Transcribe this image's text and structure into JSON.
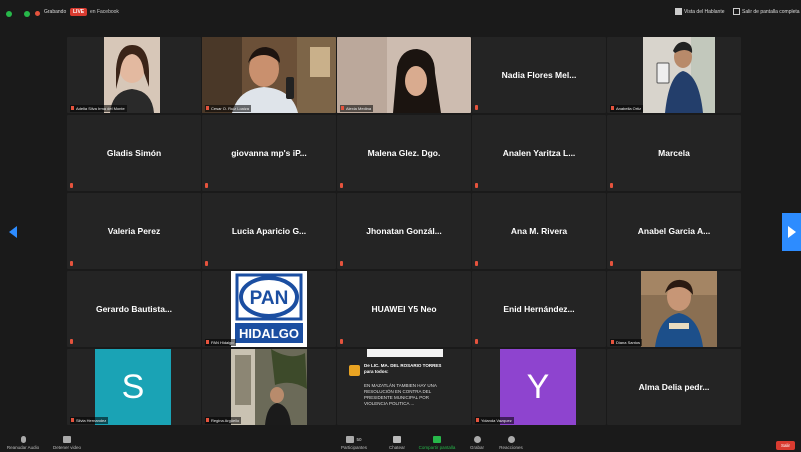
{
  "topbar": {
    "meeting_label": "Grabando",
    "live_badge": "LIVE",
    "live_text": "en Facebook",
    "view_label": "Vista del Hablante",
    "fullscreen_label": "Salir de pantalla completa"
  },
  "tiles": [
    {
      "id": "r0c0",
      "name": "Adelia Silva Irma del Monte",
      "kind": "photo"
    },
    {
      "id": "r0c1",
      "name": "Cesar O. Ruiz Loaiza",
      "kind": "photo"
    },
    {
      "id": "r0c2",
      "name": "Alexia Medina",
      "kind": "photo"
    },
    {
      "id": "r0c3",
      "name": "Nadia Flores Mel...",
      "kind": "text"
    },
    {
      "id": "r0c4",
      "name": "Anabella Ortiz",
      "kind": "photo"
    },
    {
      "id": "r1c0",
      "name": "Gladis Simón",
      "kind": "text"
    },
    {
      "id": "r1c1",
      "name": "giovanna mp's iP...",
      "kind": "text"
    },
    {
      "id": "r1c2",
      "name": "Malena Glez. Dgo.",
      "kind": "text"
    },
    {
      "id": "r1c3",
      "name": "Analen Yaritza L...",
      "kind": "text"
    },
    {
      "id": "r1c4",
      "name": "Marcela",
      "kind": "text"
    },
    {
      "id": "r2c0",
      "name": "Valeria Perez",
      "kind": "text"
    },
    {
      "id": "r2c1",
      "name": "Lucia Aparicio G...",
      "kind": "text"
    },
    {
      "id": "r2c2",
      "name": "Jhonatan Gonzál...",
      "kind": "text"
    },
    {
      "id": "r2c3",
      "name": "Ana M. Rivera",
      "kind": "text"
    },
    {
      "id": "r2c4",
      "name": "Anabel Garcia A...",
      "kind": "text"
    },
    {
      "id": "r3c0",
      "name": "Gerardo Bautista...",
      "kind": "text"
    },
    {
      "id": "r3c1",
      "name": "PAN Hidalgo",
      "kind": "logo"
    },
    {
      "id": "r3c2",
      "name": "HUAWEI Y5 Neo",
      "kind": "text"
    },
    {
      "id": "r3c3",
      "name": "Enid Hernández...",
      "kind": "text"
    },
    {
      "id": "r3c4",
      "name": "Diana Santos",
      "kind": "photo"
    },
    {
      "id": "r4c0",
      "name": "Silvia Hernandez",
      "kind": "avatar",
      "letter": "S"
    },
    {
      "id": "r4c1",
      "name": "Regina Argüello",
      "kind": "photo"
    },
    {
      "id": "r4c2",
      "name": "",
      "kind": "post"
    },
    {
      "id": "r4c3",
      "name": "Yolanda Vazquez",
      "kind": "avatar",
      "letter": "Y"
    },
    {
      "id": "r4c4",
      "name": "Alma Delia pedr...",
      "kind": "text"
    }
  ],
  "pan_logo": {
    "top": "PAN",
    "bottom": "HIDALGO"
  },
  "post": {
    "author": "De LIC. MA. DEL ROSARIO TORRES para todos:",
    "body": "EN MAZATLÁN TAMBIEN HAY UNA RESOLUCIÓN EN CONTRA DEL PRESIDENTE MUNICIPAL POR VIOLENCIA POLITICA ..."
  },
  "bottombar": {
    "audio": "Reanudar Audio",
    "video": "Detener video",
    "participants": "Participantes",
    "participants_count": "50",
    "chat": "Chatear",
    "share": "Compartir pantalla",
    "record": "Grabar",
    "reactions": "Reacciones",
    "leave": "Salir"
  },
  "colors": {
    "accent": "#2d8cff",
    "live": "#d93b30",
    "share": "#27b84a",
    "avatarS": "#1aa3b5",
    "avatarY": "#8e44cf"
  }
}
